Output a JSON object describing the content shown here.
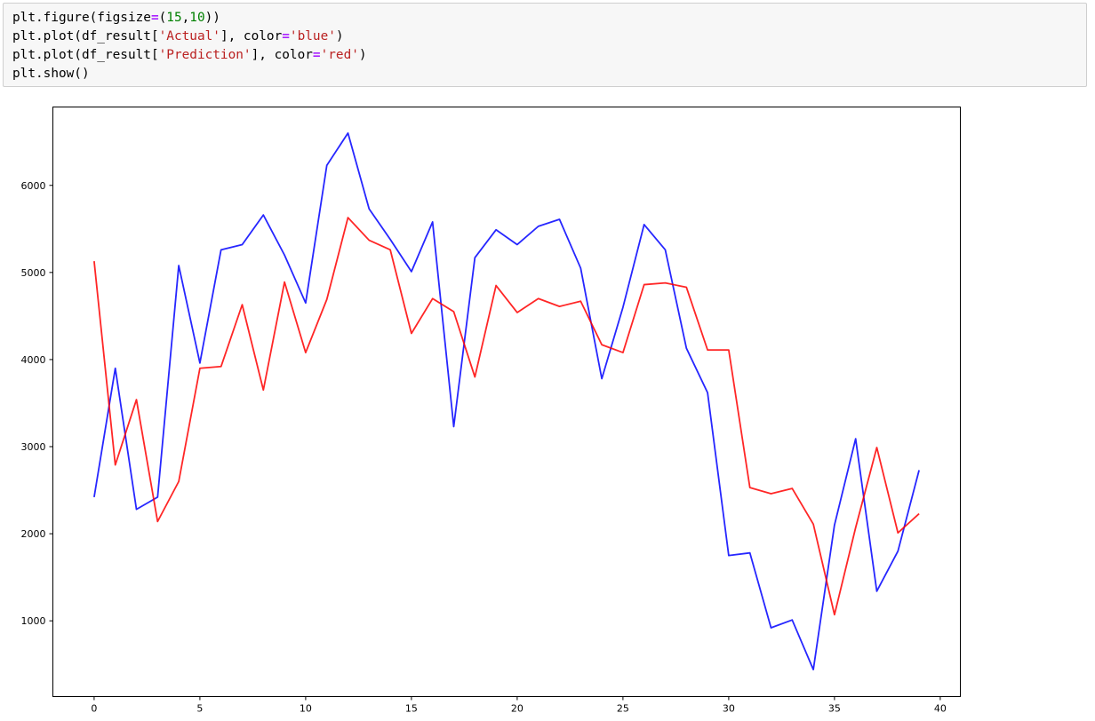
{
  "code_cell": {
    "lines": [
      [
        {
          "t": "plt.figure(figsize"
        },
        {
          "t": "=",
          "c": "op"
        },
        {
          "t": "("
        },
        {
          "t": "15",
          "c": "num"
        },
        {
          "t": ","
        },
        {
          "t": "10",
          "c": "num"
        },
        {
          "t": "))"
        }
      ],
      [
        {
          "t": "plt.plot(df_result["
        },
        {
          "t": "'Actual'",
          "c": "str"
        },
        {
          "t": "], color"
        },
        {
          "t": "=",
          "c": "op"
        },
        {
          "t": "'blue'",
          "c": "str"
        },
        {
          "t": ")"
        }
      ],
      [
        {
          "t": "plt.plot(df_result["
        },
        {
          "t": "'Prediction'",
          "c": "str"
        },
        {
          "t": "], color"
        },
        {
          "t": "=",
          "c": "op"
        },
        {
          "t": "'red'",
          "c": "str"
        },
        {
          "t": ")"
        }
      ],
      [
        {
          "t": "plt.show()"
        }
      ]
    ]
  },
  "chart_data": {
    "type": "line",
    "x": [
      0,
      1,
      2,
      3,
      4,
      5,
      6,
      7,
      8,
      9,
      10,
      11,
      12,
      13,
      14,
      15,
      16,
      17,
      18,
      19,
      20,
      21,
      22,
      23,
      24,
      25,
      26,
      27,
      28,
      29,
      30,
      31,
      32,
      33,
      34,
      35,
      36,
      37,
      38,
      39
    ],
    "series": [
      {
        "color": "#0000ff",
        "values": [
          2420,
          3900,
          2280,
          2420,
          5080,
          3960,
          5260,
          5320,
          5660,
          5200,
          4650,
          6230,
          6600,
          5730,
          5380,
          5010,
          5580,
          3230,
          5170,
          5490,
          5320,
          5530,
          5610,
          5050,
          3780,
          4600,
          5550,
          5260,
          4130,
          3620,
          1750,
          1780,
          920,
          1010,
          440,
          2100,
          3090,
          1340,
          1800,
          2730
        ]
      },
      {
        "color": "#ff0000",
        "values": [
          5130,
          2790,
          3540,
          2140,
          2600,
          3900,
          3920,
          4630,
          3650,
          4890,
          4080,
          4690,
          5630,
          5370,
          5260,
          4300,
          4700,
          4550,
          3800,
          4850,
          4540,
          4700,
          4610,
          4670,
          4170,
          4080,
          4860,
          4880,
          4830,
          4110,
          4110,
          2530,
          2460,
          2520,
          2110,
          1070,
          2070,
          2990,
          2010,
          2230
        ]
      }
    ],
    "xticks": [
      0,
      5,
      10,
      15,
      20,
      25,
      30,
      35,
      40
    ],
    "yticks": [
      1000,
      2000,
      3000,
      4000,
      5000,
      6000
    ],
    "xlim": [
      -1.95,
      40.95
    ],
    "ylim": [
      130,
      6900
    ],
    "grid": false
  }
}
